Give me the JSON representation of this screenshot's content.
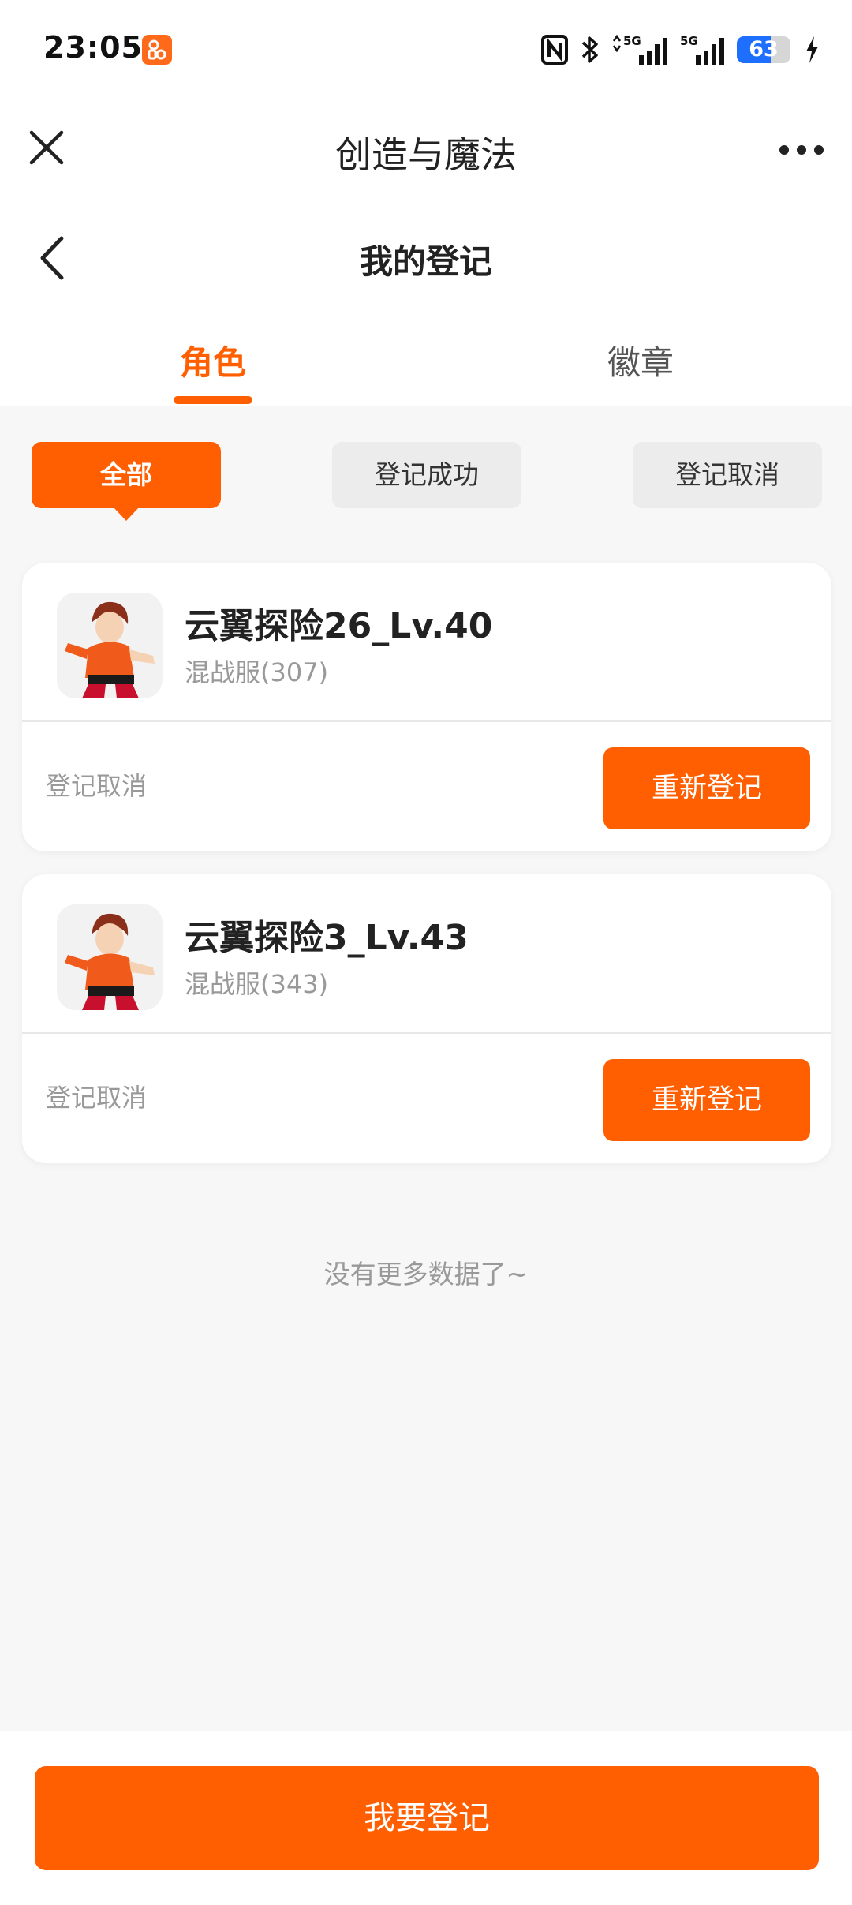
{
  "status_bar": {
    "time": "23:05",
    "network_1": "5G",
    "network_2": "5G",
    "battery_percent": 63
  },
  "app_header": {
    "title": "创造与魔法",
    "close_icon": "close-icon",
    "more_icon": "more-icon"
  },
  "page_header": {
    "title": "我的登记",
    "back_icon": "back-icon"
  },
  "tabs": [
    {
      "label": "角色",
      "active": true
    },
    {
      "label": "徽章",
      "active": false
    }
  ],
  "filters": [
    {
      "label": "全部",
      "active": true
    },
    {
      "label": "登记成功",
      "active": false
    },
    {
      "label": "登记取消",
      "active": false
    }
  ],
  "cards": [
    {
      "name": "云翼探险26_Lv.40",
      "server": "混战服(307)",
      "status": "登记取消",
      "action": "重新登记"
    },
    {
      "name": "云翼探险3_Lv.43",
      "server": "混战服(343)",
      "status": "登记取消",
      "action": "重新登记"
    }
  ],
  "no_more": "没有更多数据了~",
  "bottom": {
    "button": "我要登记"
  },
  "colors": {
    "accent": "#ff5f00",
    "background": "#f7f7f7",
    "muted_text": "#999999"
  }
}
